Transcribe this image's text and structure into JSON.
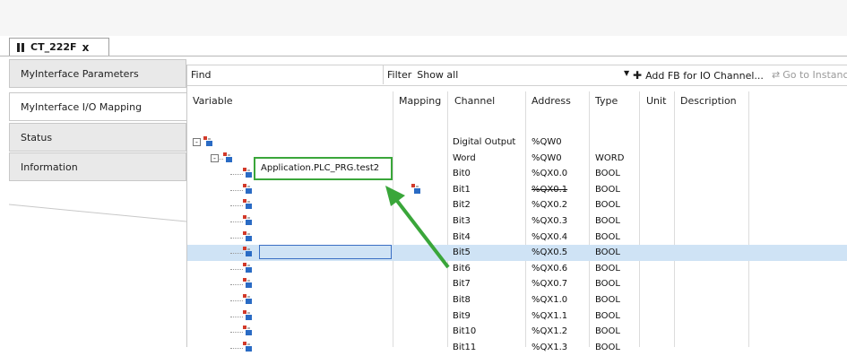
{
  "tab": {
    "title": "CT_222F",
    "close": "x"
  },
  "sidebar": {
    "items": [
      {
        "label": "MyInterface Parameters"
      },
      {
        "label": "MyInterface I/O Mapping"
      },
      {
        "label": "Status"
      },
      {
        "label": "Information"
      }
    ],
    "active_index": 1
  },
  "toolbar": {
    "find_label": "Find",
    "filter_label": "Filter",
    "filter_value": "Show all",
    "add_fb_label": "Add FB for IO Channel...",
    "goto_label": "Go to Instance"
  },
  "grid": {
    "headers": {
      "variable": "Variable",
      "mapping": "Mapping",
      "channel": "Channel",
      "address": "Address",
      "type": "Type",
      "unit": "Unit",
      "description": "Description"
    },
    "rows": [
      {
        "channel": "Digital Output",
        "address": "%QW0",
        "type": ""
      },
      {
        "channel": "Word",
        "address": "%QW0",
        "type": "WORD"
      },
      {
        "channel": "Bit0",
        "address": "%QX0.0",
        "type": "BOOL"
      },
      {
        "channel": "Bit1",
        "address": "%QX0.1",
        "type": "BOOL",
        "variable": "Application.PLC_PRG.test2"
      },
      {
        "channel": "Bit2",
        "address": "%QX0.2",
        "type": "BOOL"
      },
      {
        "channel": "Bit3",
        "address": "%QX0.3",
        "type": "BOOL"
      },
      {
        "channel": "Bit4",
        "address": "%QX0.4",
        "type": "BOOL"
      },
      {
        "channel": "Bit5",
        "address": "%QX0.5",
        "type": "BOOL"
      },
      {
        "channel": "Bit6",
        "address": "%QX0.6",
        "type": "BOOL"
      },
      {
        "channel": "Bit7",
        "address": "%QX0.7",
        "type": "BOOL"
      },
      {
        "channel": "Bit8",
        "address": "%QX1.0",
        "type": "BOOL"
      },
      {
        "channel": "Bit9",
        "address": "%QX1.1",
        "type": "BOOL"
      },
      {
        "channel": "Bit10",
        "address": "%QX1.2",
        "type": "BOOL"
      },
      {
        "channel": "Bit11",
        "address": "%QX1.3",
        "type": "BOOL"
      }
    ]
  },
  "colors": {
    "selection": "#cfe3f5",
    "annotation": "#3aa63a",
    "icon_red": "#d23a2a",
    "icon_blue": "#2a6bc4"
  }
}
